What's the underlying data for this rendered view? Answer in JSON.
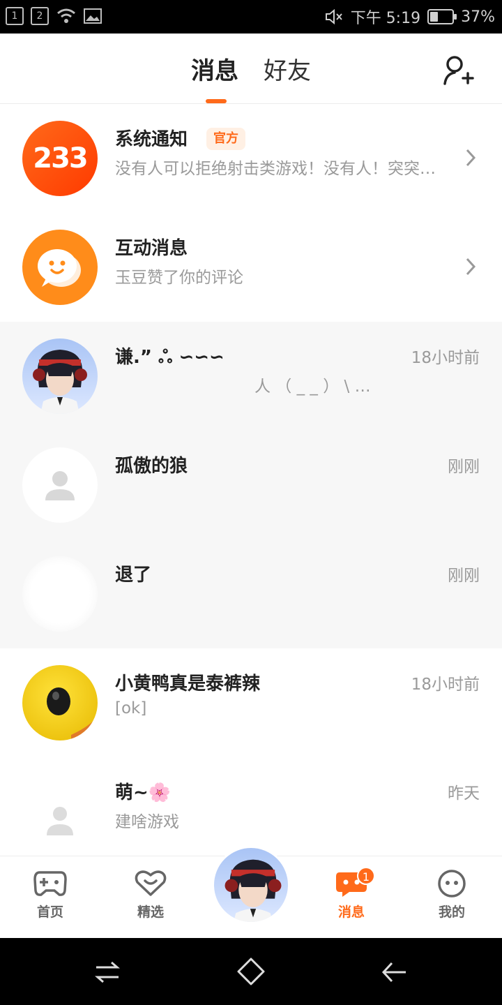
{
  "status_bar": {
    "sim1": "1",
    "sim2": "2",
    "time": "下午 5:19",
    "battery": "37%",
    "battery_level": 0.37
  },
  "header": {
    "tab_messages": "消息",
    "tab_friends": "好友",
    "add_friend_icon": "add-user-icon"
  },
  "conversations": [
    {
      "name": "系统通知",
      "tag": "官方",
      "preview": "没有人可以拒绝射击类游戏！没有人！突突…",
      "avatar_text": "233"
    },
    {
      "name": "互动消息",
      "preview": "玉豆赞了你的评论"
    },
    {
      "name": "谦.”  ஃ ∽∽∽",
      "preview": "人 （ _ _ ） \\ …",
      "time": "18小时前"
    },
    {
      "name": "孤傲的狼",
      "preview": "",
      "time": "刚刚"
    },
    {
      "name": "退了",
      "preview": "",
      "time": "刚刚"
    },
    {
      "name": "小黄鸭真是泰裤辣",
      "preview": "[ok]",
      "time": "18小时前"
    },
    {
      "name": "萌~🌸",
      "preview": "建啥游戏",
      "time": "昨天"
    }
  ],
  "bottom_nav": {
    "home": "首页",
    "featured": "精选",
    "messages": "消息",
    "messages_badge": "1",
    "mine": "我的"
  },
  "colors": {
    "accent": "#ff6a1a",
    "grey_row": "#f7f7f7",
    "text_secondary": "#9a9a9a"
  }
}
